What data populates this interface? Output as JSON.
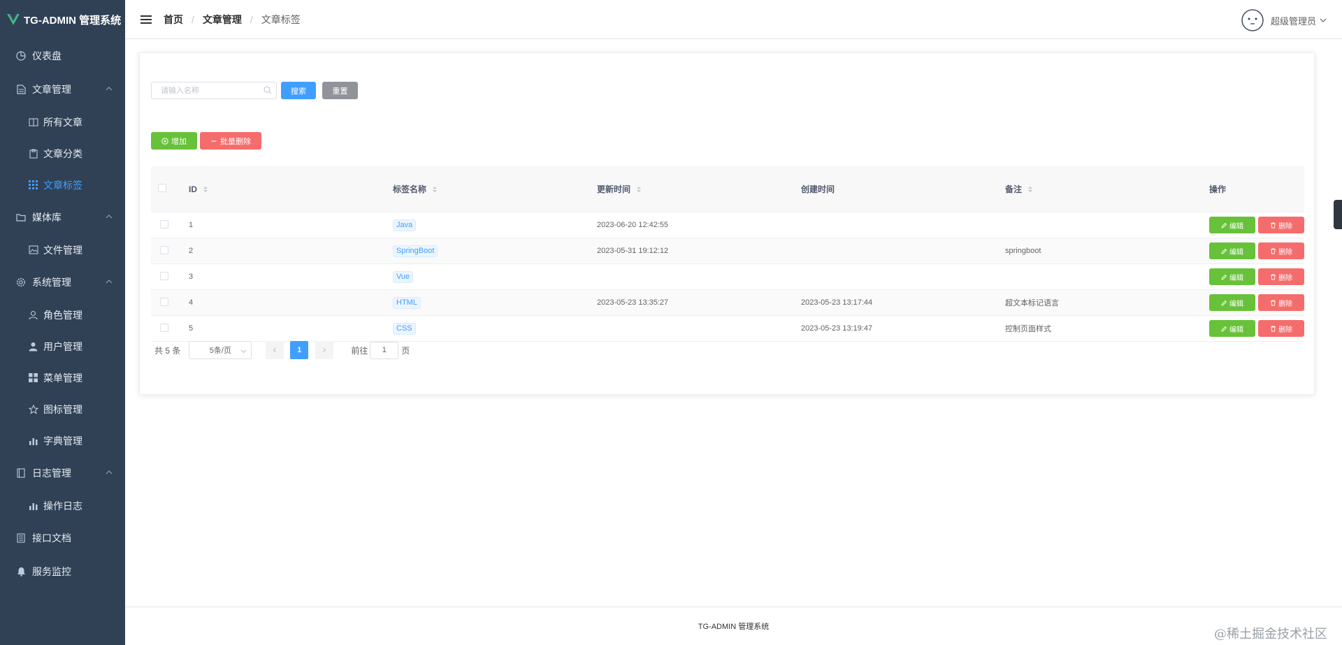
{
  "app": {
    "title": "TG-ADMIN 管理系统"
  },
  "sidebar": {
    "items": [
      {
        "label": "仪表盘",
        "icon": "dashboard-icon"
      },
      {
        "label": "文章管理",
        "icon": "document-icon",
        "expanded": true,
        "children": [
          {
            "label": "所有文章",
            "icon": "book-icon"
          },
          {
            "label": "文章分类",
            "icon": "clipboard-icon"
          },
          {
            "label": "文章标签",
            "icon": "grid-icon",
            "active": true
          }
        ]
      },
      {
        "label": "媒体库",
        "icon": "folder-icon",
        "expanded": true,
        "children": [
          {
            "label": "文件管理",
            "icon": "picture-icon"
          }
        ]
      },
      {
        "label": "系统管理",
        "icon": "gear-icon",
        "expanded": true,
        "children": [
          {
            "label": "角色管理",
            "icon": "user-outline-icon"
          },
          {
            "label": "用户管理",
            "icon": "user-filled-icon"
          },
          {
            "label": "菜单管理",
            "icon": "menu-grid-icon"
          },
          {
            "label": "图标管理",
            "icon": "star-icon"
          },
          {
            "label": "字典管理",
            "icon": "bar-chart-icon"
          }
        ]
      },
      {
        "label": "日志管理",
        "icon": "notebook-icon",
        "expanded": true,
        "children": [
          {
            "label": "操作日志",
            "icon": "bar-chart-icon"
          }
        ]
      },
      {
        "label": "接口文档",
        "icon": "tickets-icon"
      },
      {
        "label": "服务监控",
        "icon": "bell-icon"
      }
    ]
  },
  "header": {
    "breadcrumb": [
      "首页",
      "文章管理",
      "文章标签"
    ],
    "user_name": "超级管理员"
  },
  "search": {
    "placeholder": "请输入名称",
    "search_label": "搜索",
    "reset_label": "重置"
  },
  "actions": {
    "add_label": "增加",
    "batch_delete_label": "批量删除"
  },
  "table": {
    "columns": [
      "ID",
      "标签名称",
      "更新时间",
      "创建时间",
      "备注",
      "操作"
    ],
    "rows": [
      {
        "id": "1",
        "name": "Java",
        "updated": "2023-06-20 12:42:55",
        "created": "",
        "note": ""
      },
      {
        "id": "2",
        "name": "SpringBoot",
        "updated": "2023-05-31 19:12:12",
        "created": "",
        "note": "springboot"
      },
      {
        "id": "3",
        "name": "Vue",
        "updated": "",
        "created": "",
        "note": ""
      },
      {
        "id": "4",
        "name": "HTML",
        "updated": "2023-05-23 13:35:27",
        "created": "2023-05-23 13:17:44",
        "note": "超文本标记语言"
      },
      {
        "id": "5",
        "name": "CSS",
        "updated": "",
        "created": "2023-05-23 13:19:47",
        "note": "控制页面样式"
      }
    ],
    "edit_label": "编辑",
    "delete_label": "删除"
  },
  "pagination": {
    "total_text": "共 5 条",
    "page_size": "5条/页",
    "current_page": "1",
    "goto_label": "前往",
    "goto_value": "1",
    "page_suffix": "页"
  },
  "footer": {
    "text": "TG-ADMIN 管理系统"
  },
  "watermark": "@稀土掘金技术社区",
  "colors": {
    "sidebar_bg": "#304156",
    "primary": "#409eff",
    "success": "#67c23a",
    "danger": "#f56c6c",
    "info": "#909399"
  }
}
